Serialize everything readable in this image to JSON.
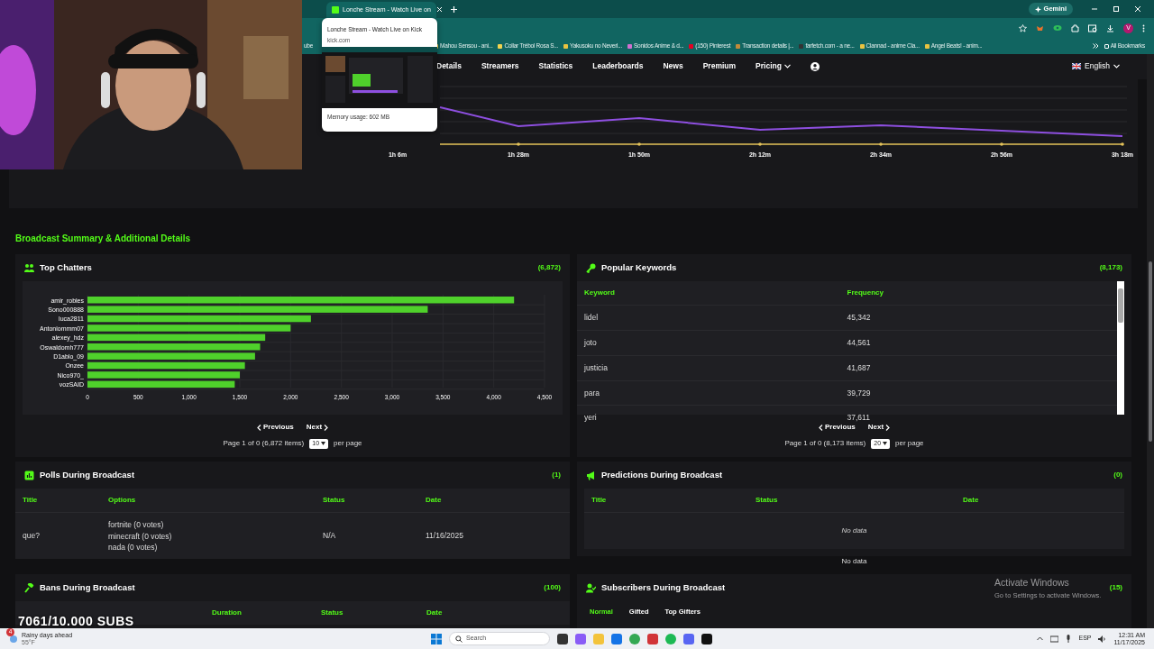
{
  "browser": {
    "tabs": [
      {
        "title": "Lonche Stream - Watch Live on",
        "selected": true
      }
    ],
    "gemini_button": "Gemini",
    "profile_initial": "V",
    "bookmarks": [
      "ube",
      "Mahou Sensou - ani...",
      "Collar Trébol Rosa S...",
      "Yakusoku no Neverl...",
      "Sonidos Anime & d...",
      "(150) Pinterest",
      "Transaction details |...",
      "farfetch.com - a ne...",
      "Clannad - anime Cla...",
      "Angel Beats! - anim..."
    ],
    "all_bookmarks": "All Bookmarks",
    "tab_preview": {
      "title": "Lonche Stream - Watch Live on Kick",
      "domain": "kick.com",
      "memory": "Memory usage: 602 MB"
    }
  },
  "nav": {
    "items": [
      "Details",
      "Streamers",
      "Statistics",
      "Leaderboards",
      "News",
      "Premium",
      "Pricing"
    ],
    "language": "English"
  },
  "viewer_chart": {
    "x_labels": [
      "1h 6m",
      "1h 28m",
      "1h 50m",
      "2h 12m",
      "2h 34m",
      "2h 56m",
      "3h 18m"
    ]
  },
  "section_title": "Broadcast Summary & Additional Details",
  "top_chatters": {
    "title": "Top Chatters",
    "count": "(6,872)",
    "chart_data": {
      "type": "bar",
      "orientation": "horizontal",
      "categories": [
        "amir_robles",
        "Sono000888",
        "luca2811",
        "Antoniommm07",
        "alexey_hdz",
        "Oswaldomh777",
        "D1ablo_09",
        "Onzee",
        "Nico970_",
        "vozSAID"
      ],
      "values": [
        4200,
        3350,
        2200,
        2000,
        1750,
        1700,
        1650,
        1550,
        1500,
        1450
      ],
      "xlim": [
        0,
        4500
      ],
      "grid": true,
      "xticks": [
        {
          "value": 0,
          "label": "0"
        },
        {
          "value": 500,
          "label": "500"
        },
        {
          "value": 1000,
          "label": "1,000"
        },
        {
          "value": 1500,
          "label": "1,500"
        },
        {
          "value": 2000,
          "label": "2,000"
        },
        {
          "value": 2500,
          "label": "2,500"
        },
        {
          "value": 3000,
          "label": "3,000"
        },
        {
          "value": 3500,
          "label": "3,500"
        },
        {
          "value": 4000,
          "label": "4,000"
        },
        {
          "value": 4500,
          "label": "4,500"
        }
      ]
    },
    "pagination": {
      "previous": "Previous",
      "next": "Next",
      "info": "Page 1 of 0 (6,872 items)",
      "per_page_value": "10",
      "per_page_label": "per page"
    }
  },
  "popular_keywords": {
    "title": "Popular Keywords",
    "count": "(8,173)",
    "columns": [
      "Keyword",
      "Frequency"
    ],
    "rows": [
      [
        "lidel",
        "45,342"
      ],
      [
        "joto",
        "44,561"
      ],
      [
        "justicia",
        "41,687"
      ],
      [
        "para",
        "39,729"
      ],
      [
        "yeri",
        "37,611"
      ]
    ],
    "pagination": {
      "previous": "Previous",
      "next": "Next",
      "info": "Page 1 of 0 (8,173 items)",
      "per_page_value": "20",
      "per_page_label": "per page"
    }
  },
  "polls": {
    "title": "Polls During Broadcast",
    "count": "(1)",
    "columns": [
      "Title",
      "Options",
      "Status",
      "Date"
    ],
    "rows": [
      {
        "title": "que?",
        "options": [
          "fortnite (0 votes)",
          "minecraft (0 votes)",
          "nada (0 votes)"
        ],
        "status": "N/A",
        "date": "11/16/2025"
      }
    ]
  },
  "predictions": {
    "title": "Predictions During Broadcast",
    "count": "(0)",
    "columns": [
      "Title",
      "Status",
      "Date"
    ],
    "empty_text": "No data",
    "footer_text": "No data"
  },
  "bans": {
    "title": "Bans During Broadcast",
    "count": "(100)",
    "columns": [
      "Duration",
      "Status",
      "Date"
    ]
  },
  "subscribers": {
    "title": "Subscribers During Broadcast",
    "count": "(15)",
    "tabs": [
      {
        "label": "Normal",
        "selected": true
      },
      {
        "label": "Gifted",
        "selected": false
      },
      {
        "label": "Top Gifters",
        "selected": false
      }
    ]
  },
  "stream_overlay": {
    "sub_goal": "7061/10.000 SUBS"
  },
  "windows_watermark": {
    "title": "Activate Windows",
    "subtitle": "Go to Settings to activate Windows."
  },
  "taskbar": {
    "weather": {
      "badge": "4",
      "text": "Rainy days ahead",
      "temp": "55°F"
    },
    "search_placeholder": "Search",
    "language": "ESP",
    "time": "12:31 AM",
    "date": "11/17/2025"
  }
}
